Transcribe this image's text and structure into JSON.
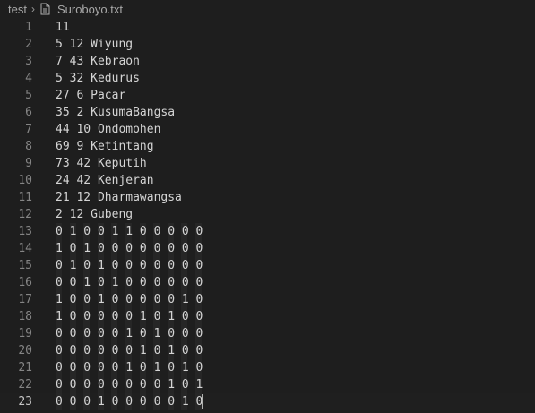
{
  "breadcrumb": {
    "folder": "test",
    "file": "Suroboyo.txt"
  },
  "editor": {
    "current_line": 23,
    "lines": [
      "11",
      "5 12 Wiyung",
      "7 43 Kebraon",
      "5 32 Kedurus",
      "27 6 Pacar",
      "35 2 KusumaBangsa",
      "44 10 Ondomohen",
      "69 9 Ketintang",
      "73 42 Keputih",
      "24 42 Kenjeran",
      "21 12 Dharmawangsa",
      "2 12 Gubeng",
      "0 1 0 0 1 1 0 0 0 0 0",
      "1 0 1 0 0 0 0 0 0 0 0",
      "0 1 0 1 0 0 0 0 0 0 0",
      "0 0 1 0 1 0 0 0 0 0 0",
      "1 0 0 1 0 0 0 0 0 1 0",
      "1 0 0 0 0 0 1 0 1 0 0",
      "0 0 0 0 0 1 0 1 0 0 0",
      "0 0 0 0 0 0 1 0 1 0 0",
      "0 0 0 0 0 1 0 1 0 1 0",
      "0 0 0 0 0 0 0 0 1 0 1",
      "0 0 0 1 0 0 0 0 0 1 0"
    ]
  }
}
